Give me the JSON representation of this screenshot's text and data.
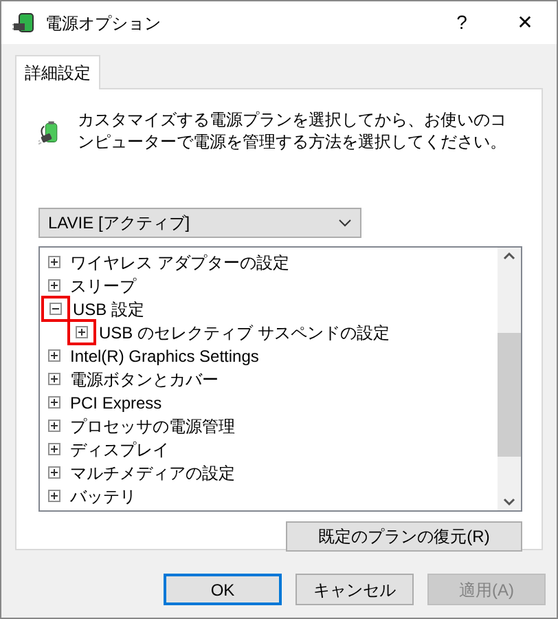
{
  "window": {
    "title": "電源オプション",
    "help": "?",
    "close": "✕"
  },
  "tabs": [
    {
      "label": "詳細設定",
      "selected": true
    }
  ],
  "description": "カスタマイズする電源プランを選択してから、お使いのコンピューターで電源を管理する方法を選択してください。",
  "plan_select": {
    "value": "LAVIE [アクティブ]"
  },
  "tree": [
    {
      "label": "ワイヤレス アダプターの設定",
      "expanded": false,
      "highlighted": false
    },
    {
      "label": "スリープ",
      "expanded": false,
      "highlighted": false
    },
    {
      "label": "USB 設定",
      "expanded": true,
      "highlighted": true,
      "children": [
        {
          "label": "USB のセレクティブ サスペンドの設定",
          "expanded": false,
          "highlighted": true
        }
      ]
    },
    {
      "label": "Intel(R) Graphics Settings",
      "expanded": false,
      "highlighted": false
    },
    {
      "label": "電源ボタンとカバー",
      "expanded": false,
      "highlighted": false
    },
    {
      "label": "PCI Express",
      "expanded": false,
      "highlighted": false
    },
    {
      "label": "プロセッサの電源管理",
      "expanded": false,
      "highlighted": false
    },
    {
      "label": "ディスプレイ",
      "expanded": false,
      "highlighted": false
    },
    {
      "label": "マルチメディアの設定",
      "expanded": false,
      "highlighted": false
    },
    {
      "label": "バッテリ",
      "expanded": false,
      "highlighted": false
    }
  ],
  "restore_button": "既定のプランの復元(R)",
  "buttons": [
    {
      "label": "OK",
      "kind": "default",
      "disabled": false
    },
    {
      "label": "キャンセル",
      "kind": "normal",
      "disabled": false
    },
    {
      "label": "適用(A)",
      "kind": "normal",
      "disabled": true
    }
  ]
}
